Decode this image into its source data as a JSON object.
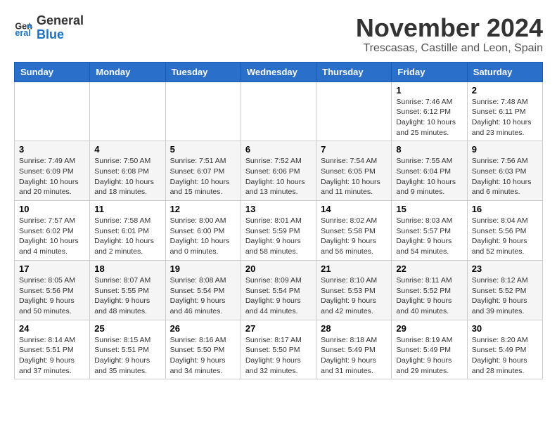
{
  "header": {
    "logo_line1": "General",
    "logo_line2": "Blue",
    "month": "November 2024",
    "location": "Trescasas, Castille and Leon, Spain"
  },
  "weekdays": [
    "Sunday",
    "Monday",
    "Tuesday",
    "Wednesday",
    "Thursday",
    "Friday",
    "Saturday"
  ],
  "weeks": [
    [
      {
        "day": "",
        "info": ""
      },
      {
        "day": "",
        "info": ""
      },
      {
        "day": "",
        "info": ""
      },
      {
        "day": "",
        "info": ""
      },
      {
        "day": "",
        "info": ""
      },
      {
        "day": "1",
        "info": "Sunrise: 7:46 AM\nSunset: 6:12 PM\nDaylight: 10 hours and 25 minutes."
      },
      {
        "day": "2",
        "info": "Sunrise: 7:48 AM\nSunset: 6:11 PM\nDaylight: 10 hours and 23 minutes."
      }
    ],
    [
      {
        "day": "3",
        "info": "Sunrise: 7:49 AM\nSunset: 6:09 PM\nDaylight: 10 hours and 20 minutes."
      },
      {
        "day": "4",
        "info": "Sunrise: 7:50 AM\nSunset: 6:08 PM\nDaylight: 10 hours and 18 minutes."
      },
      {
        "day": "5",
        "info": "Sunrise: 7:51 AM\nSunset: 6:07 PM\nDaylight: 10 hours and 15 minutes."
      },
      {
        "day": "6",
        "info": "Sunrise: 7:52 AM\nSunset: 6:06 PM\nDaylight: 10 hours and 13 minutes."
      },
      {
        "day": "7",
        "info": "Sunrise: 7:54 AM\nSunset: 6:05 PM\nDaylight: 10 hours and 11 minutes."
      },
      {
        "day": "8",
        "info": "Sunrise: 7:55 AM\nSunset: 6:04 PM\nDaylight: 10 hours and 9 minutes."
      },
      {
        "day": "9",
        "info": "Sunrise: 7:56 AM\nSunset: 6:03 PM\nDaylight: 10 hours and 6 minutes."
      }
    ],
    [
      {
        "day": "10",
        "info": "Sunrise: 7:57 AM\nSunset: 6:02 PM\nDaylight: 10 hours and 4 minutes."
      },
      {
        "day": "11",
        "info": "Sunrise: 7:58 AM\nSunset: 6:01 PM\nDaylight: 10 hours and 2 minutes."
      },
      {
        "day": "12",
        "info": "Sunrise: 8:00 AM\nSunset: 6:00 PM\nDaylight: 10 hours and 0 minutes."
      },
      {
        "day": "13",
        "info": "Sunrise: 8:01 AM\nSunset: 5:59 PM\nDaylight: 9 hours and 58 minutes."
      },
      {
        "day": "14",
        "info": "Sunrise: 8:02 AM\nSunset: 5:58 PM\nDaylight: 9 hours and 56 minutes."
      },
      {
        "day": "15",
        "info": "Sunrise: 8:03 AM\nSunset: 5:57 PM\nDaylight: 9 hours and 54 minutes."
      },
      {
        "day": "16",
        "info": "Sunrise: 8:04 AM\nSunset: 5:56 PM\nDaylight: 9 hours and 52 minutes."
      }
    ],
    [
      {
        "day": "17",
        "info": "Sunrise: 8:05 AM\nSunset: 5:56 PM\nDaylight: 9 hours and 50 minutes."
      },
      {
        "day": "18",
        "info": "Sunrise: 8:07 AM\nSunset: 5:55 PM\nDaylight: 9 hours and 48 minutes."
      },
      {
        "day": "19",
        "info": "Sunrise: 8:08 AM\nSunset: 5:54 PM\nDaylight: 9 hours and 46 minutes."
      },
      {
        "day": "20",
        "info": "Sunrise: 8:09 AM\nSunset: 5:54 PM\nDaylight: 9 hours and 44 minutes."
      },
      {
        "day": "21",
        "info": "Sunrise: 8:10 AM\nSunset: 5:53 PM\nDaylight: 9 hours and 42 minutes."
      },
      {
        "day": "22",
        "info": "Sunrise: 8:11 AM\nSunset: 5:52 PM\nDaylight: 9 hours and 40 minutes."
      },
      {
        "day": "23",
        "info": "Sunrise: 8:12 AM\nSunset: 5:52 PM\nDaylight: 9 hours and 39 minutes."
      }
    ],
    [
      {
        "day": "24",
        "info": "Sunrise: 8:14 AM\nSunset: 5:51 PM\nDaylight: 9 hours and 37 minutes."
      },
      {
        "day": "25",
        "info": "Sunrise: 8:15 AM\nSunset: 5:51 PM\nDaylight: 9 hours and 35 minutes."
      },
      {
        "day": "26",
        "info": "Sunrise: 8:16 AM\nSunset: 5:50 PM\nDaylight: 9 hours and 34 minutes."
      },
      {
        "day": "27",
        "info": "Sunrise: 8:17 AM\nSunset: 5:50 PM\nDaylight: 9 hours and 32 minutes."
      },
      {
        "day": "28",
        "info": "Sunrise: 8:18 AM\nSunset: 5:49 PM\nDaylight: 9 hours and 31 minutes."
      },
      {
        "day": "29",
        "info": "Sunrise: 8:19 AM\nSunset: 5:49 PM\nDaylight: 9 hours and 29 minutes."
      },
      {
        "day": "30",
        "info": "Sunrise: 8:20 AM\nSunset: 5:49 PM\nDaylight: 9 hours and 28 minutes."
      }
    ]
  ]
}
